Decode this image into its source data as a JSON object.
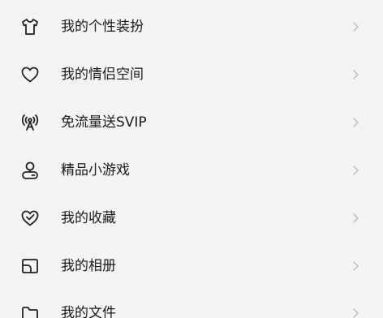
{
  "menu": {
    "items": [
      {
        "icon": "tshirt-icon",
        "label": "我的个性装扮"
      },
      {
        "icon": "heart-icon",
        "label": "我的情侣空间"
      },
      {
        "icon": "antenna-icon",
        "label": "免流量送SVIP"
      },
      {
        "icon": "game-pin-icon",
        "label": "精品小游戏"
      },
      {
        "icon": "heart-check-icon",
        "label": "我的收藏"
      },
      {
        "icon": "photo-album-icon",
        "label": "我的相册"
      },
      {
        "icon": "folder-icon",
        "label": "我的文件"
      }
    ]
  },
  "colors": {
    "background": "#f4f4f4",
    "text": "#1a1a1a",
    "icon": "#222222",
    "chevron": "#b5b5b5"
  }
}
